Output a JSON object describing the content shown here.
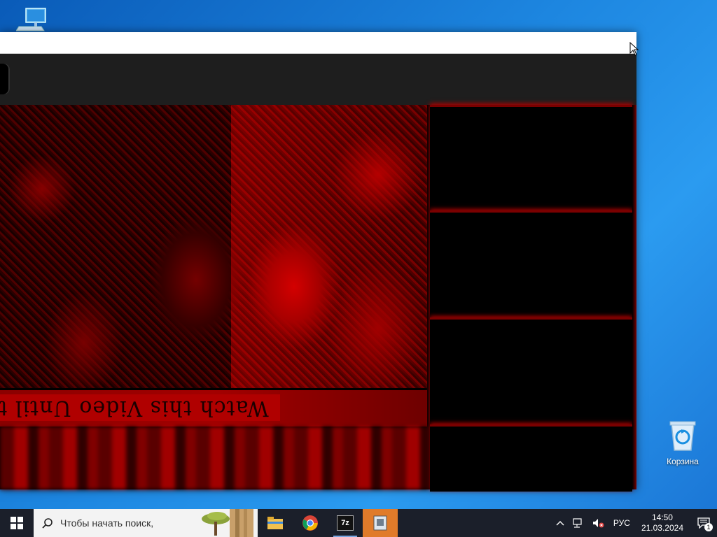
{
  "desktop": {
    "this_pc_label": "",
    "recycle_bin_label": "Корзина"
  },
  "window": {
    "title": "",
    "video_caption": "Watch this Video Until th",
    "accent_color": "#b00000"
  },
  "taskbar": {
    "search_placeholder": "Чтобы начать поиск,",
    "apps": [
      "file-explorer-icon",
      "chrome-icon",
      "7zip-icon",
      "active-app-icon"
    ],
    "seven_zip_label": "7z",
    "language": "РУС",
    "time": "14:50",
    "date": "21.03.2024",
    "notification_count": "1"
  }
}
